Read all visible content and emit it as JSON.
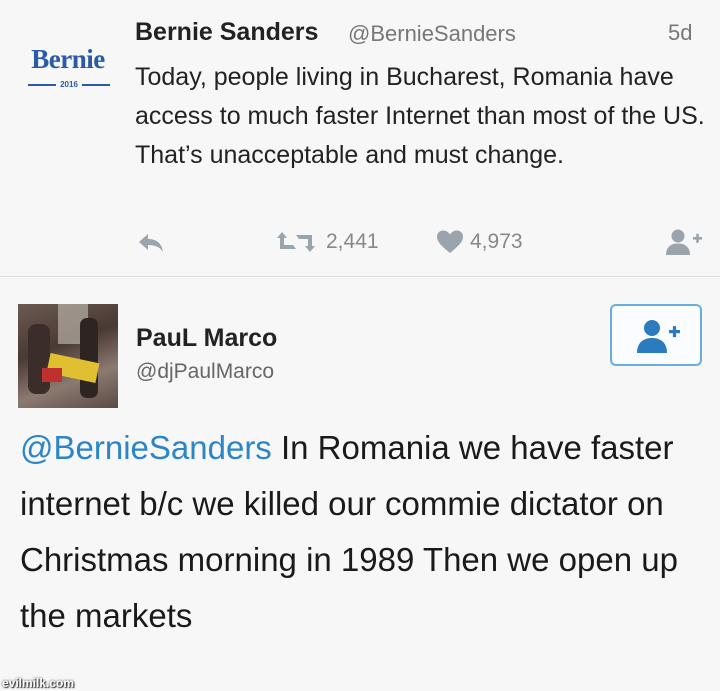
{
  "tweet1": {
    "logo": {
      "word": "Bernie",
      "year": "2016"
    },
    "author_name": "Bernie Sanders",
    "handle": "@BernieSanders",
    "time": "5d",
    "text": "Today, people living in Bucharest, Romania have access to much faster Internet than most of the US. That’s unacceptable and must change.",
    "retweets": "2,441",
    "likes": "4,973",
    "icons": [
      "reply-icon",
      "retweet-icon",
      "heart-icon",
      "follow-icon"
    ]
  },
  "tweet2": {
    "author_name": "PauL Marco",
    "handle": "@djPaulMarco",
    "mention": "@BernieSanders",
    "text": " In Romania we have faster internet b/c we killed our commie dictator on Christmas morning in 1989  Then we open up the markets",
    "icons": [
      "avatar-photo",
      "follow-icon"
    ]
  },
  "watermark": "evilmilk.com",
  "colors": {
    "link": "#2a86c8",
    "icon_gray": "#9aa4ad",
    "follow_blue": "#2b7bbf"
  }
}
